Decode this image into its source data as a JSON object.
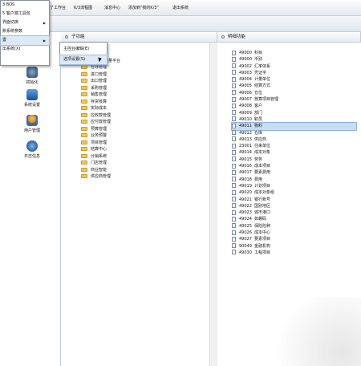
{
  "toolbar": {
    "items": [
      "了工作台",
      "K/3流程图",
      "消息中心",
      "添加到\"我的K/3\"",
      "退出系统"
    ]
  },
  "main_menu": {
    "items": [
      {
        "label": "3 BOS",
        "has_submenu": false
      },
      {
        "label": "5 客户端工具包",
        "has_submenu": false
      },
      {
        "label": "界面切换",
        "has_submenu": true
      },
      {
        "label": "账系统参数",
        "has_submenu": false
      },
      {
        "label": "置",
        "has_submenu": true
      },
      {
        "label": "出系统(X)",
        "has_submenu": false
      }
    ],
    "highlighted_index": 4
  },
  "submenu": {
    "items": [
      "主控台编辑(E)",
      "选项设置(S)"
    ],
    "highlighted_index": 1
  },
  "left_nav": {
    "items": [
      {
        "label": "初始化",
        "icon": "wrench-icon"
      },
      {
        "label": "系统设置",
        "icon": "settings-monitor-icon"
      },
      {
        "label": "用户管理",
        "icon": "users-icon"
      },
      {
        "label": "日志信息",
        "icon": "log-globe-icon"
      }
    ]
  },
  "sub_function": {
    "header": "子功能",
    "platform_label": "数量平台",
    "items": [
      "仓存管理",
      "进口管理",
      "出口管理",
      "采购管理",
      "销售管理",
      "存货核算",
      "实际成本",
      "应收款管理",
      "应付款管理",
      "预算管理",
      "业务预警",
      "项目管理",
      "结算中心",
      "分销系统",
      "门店管理",
      "商业智能",
      "供应商管理"
    ]
  },
  "detail_function": {
    "header": "明细功能",
    "selected_index": 11,
    "rows": [
      {
        "code": "49000",
        "name": "科目"
      },
      {
        "code": "49000",
        "name": "币别"
      },
      {
        "code": "49002",
        "name": "汇率体系"
      },
      {
        "code": "49003",
        "name": "凭证字"
      },
      {
        "code": "49004",
        "name": "计量单位"
      },
      {
        "code": "49005",
        "name": "结算方式"
      },
      {
        "code": "49006",
        "name": "仓位"
      },
      {
        "code": "49007",
        "name": "核算项目管理"
      },
      {
        "code": "49008",
        "name": "客户"
      },
      {
        "code": "49009",
        "name": "部门"
      },
      {
        "code": "49010",
        "name": "职员"
      },
      {
        "code": "49011",
        "name": "物料"
      },
      {
        "code": "49012",
        "name": "仓库"
      },
      {
        "code": "49013",
        "name": "供应商"
      },
      {
        "code": "23001",
        "name": "往来单位"
      },
      {
        "code": "49014",
        "name": "成本对象"
      },
      {
        "code": "49015",
        "name": "劳务"
      },
      {
        "code": "49016",
        "name": "成本项目"
      },
      {
        "code": "49017",
        "name": "要素费用"
      },
      {
        "code": "49018",
        "name": "费用"
      },
      {
        "code": "49019",
        "name": "计划项目"
      },
      {
        "code": "49020",
        "name": "成本对象组"
      },
      {
        "code": "49021",
        "name": "银行账号"
      },
      {
        "code": "49022",
        "name": "国别地区"
      },
      {
        "code": "49023",
        "name": "城市港口"
      },
      {
        "code": "49024",
        "name": "如螺码"
      },
      {
        "code": "49025",
        "name": "保险险种"
      },
      {
        "code": "49026",
        "name": "成本中心"
      },
      {
        "code": "49027",
        "name": "要素项目"
      },
      {
        "code": "90049",
        "name": "金融机构"
      },
      {
        "code": "49030",
        "name": "工程项目"
      }
    ]
  }
}
